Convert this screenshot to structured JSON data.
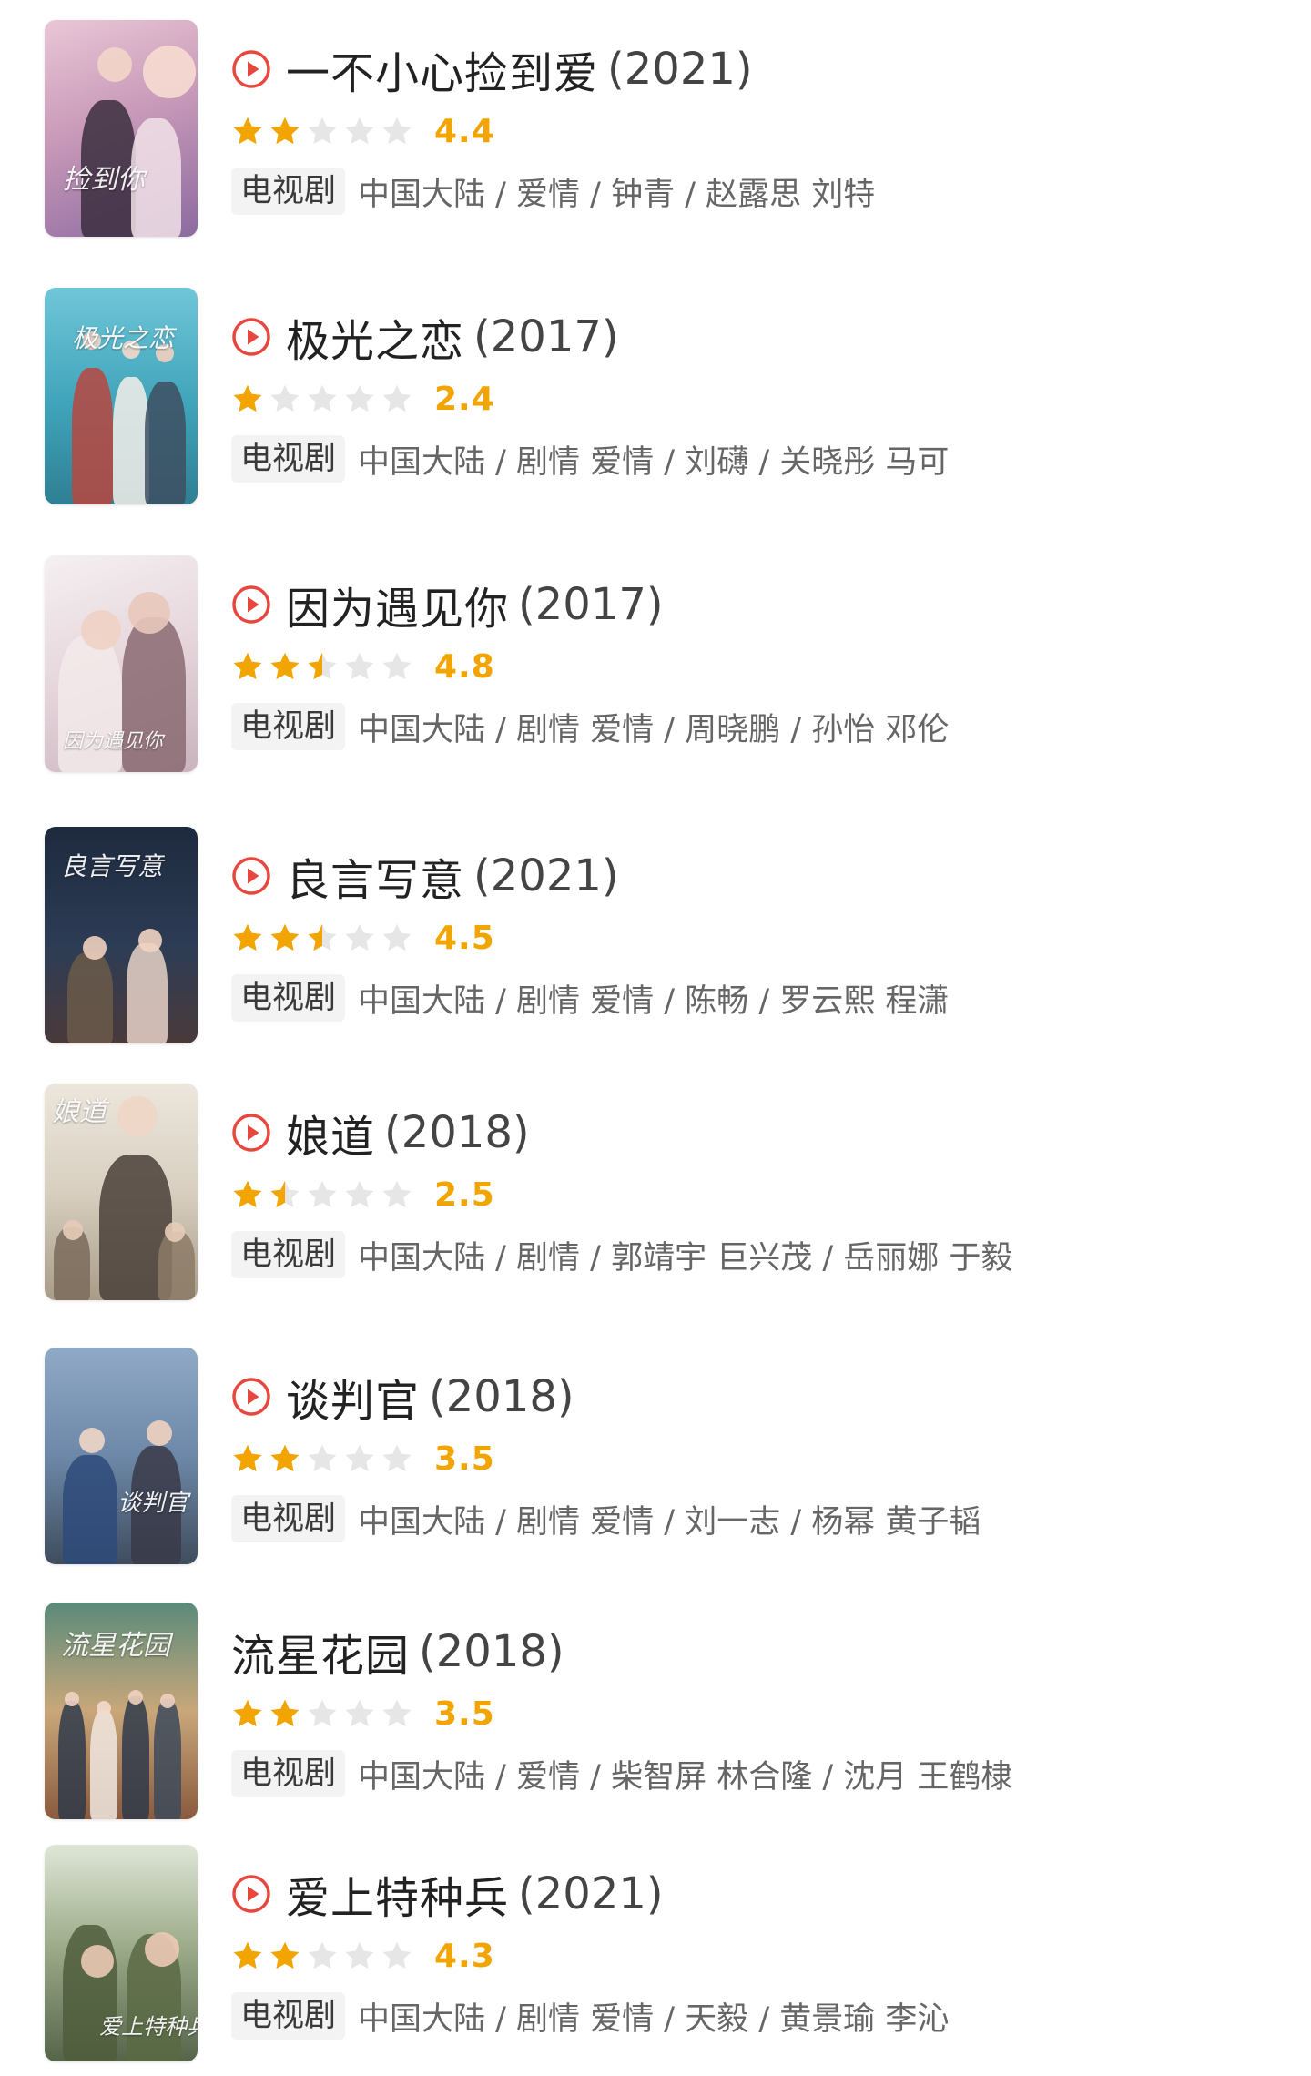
{
  "tag_label": "电视剧",
  "items": [
    {
      "title": "一不小心捡到爱",
      "year": "(2021)",
      "rating": "4.4",
      "stars_filled": 2,
      "has_play": true,
      "meta": "中国大陆 / 爱情 / 钟青 / 赵露思 刘特",
      "poster_text": "捡到你"
    },
    {
      "title": "极光之恋",
      "year": "(2017)",
      "rating": "2.4",
      "stars_filled": 1,
      "has_play": true,
      "meta": "中国大陆 / 剧情 爱情 / 刘礴 / 关晓彤 马可",
      "poster_text": "极光之恋"
    },
    {
      "title": "因为遇见你",
      "year": "(2017)",
      "rating": "4.8",
      "stars_filled": 2.5,
      "has_play": true,
      "meta": "中国大陆 / 剧情 爱情 / 周晓鹏 / 孙怡 邓伦",
      "poster_text": "因为遇见你"
    },
    {
      "title": "良言写意",
      "year": "(2021)",
      "rating": "4.5",
      "stars_filled": 2.5,
      "has_play": true,
      "meta": "中国大陆 / 剧情 爱情 / 陈畅 / 罗云熙 程潇",
      "poster_text": "良言写意"
    },
    {
      "title": "娘道",
      "year": "(2018)",
      "rating": "2.5",
      "stars_filled": 1.5,
      "has_play": true,
      "meta": "中国大陆 / 剧情 / 郭靖宇 巨兴茂 / 岳丽娜 于毅",
      "poster_text": "娘道"
    },
    {
      "title": "谈判官",
      "year": "(2018)",
      "rating": "3.5",
      "stars_filled": 2,
      "has_play": true,
      "meta": "中国大陆 / 剧情 爱情 / 刘一志 / 杨幂 黄子韬",
      "poster_text": "谈判官"
    },
    {
      "title": "流星花园",
      "year": "(2018)",
      "rating": "3.5",
      "stars_filled": 2,
      "has_play": false,
      "meta": "中国大陆 / 爱情 / 柴智屏 林合隆 / 沈月 王鹤棣",
      "poster_text": "流星花园"
    },
    {
      "title": "爱上特种兵",
      "year": "(2021)",
      "rating": "4.3",
      "stars_filled": 2,
      "has_play": true,
      "meta": "中国大陆 / 剧情 爱情 / 天毅 / 黄景瑜 李沁",
      "poster_text": "爱上特种兵"
    }
  ],
  "colors": {
    "star_filled": "#f2a400",
    "star_empty": "#e6e6e6",
    "rating_text": "#f2a400",
    "play_icon": "#e8473e"
  },
  "icons": {
    "play": "play-circle-icon",
    "star": "star-icon"
  }
}
